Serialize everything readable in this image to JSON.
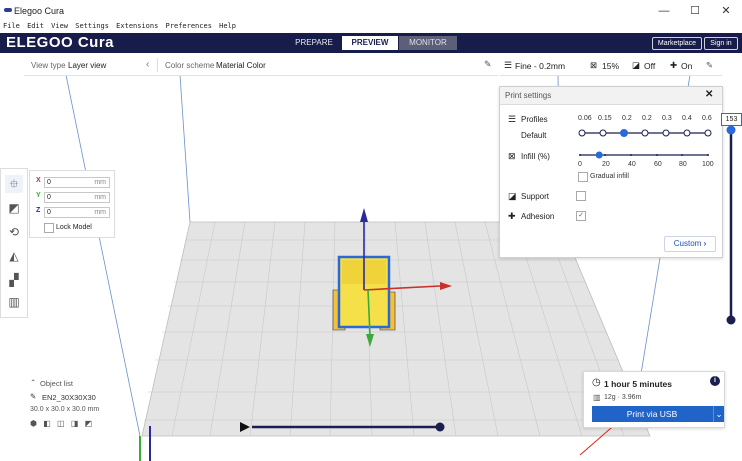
{
  "window": {
    "title": "Elegoo Cura",
    "controls": [
      "—",
      "☐",
      "✕"
    ]
  },
  "menubar": {
    "items": [
      "File",
      "Edit",
      "View",
      "Settings",
      "Extensions",
      "Preferences",
      "Help"
    ]
  },
  "header": {
    "logo": "ELEGOO Cura",
    "stages": [
      "PREPARE",
      "PREVIEW",
      "MONITOR"
    ],
    "active_stage": "PREVIEW",
    "marketplace_label": "Marketplace",
    "signin_label": "Sign in",
    "background_color": "#171c4a"
  },
  "toolbar": {
    "view_type_label": "View type",
    "view_type_value": "Layer view",
    "color_scheme_label": "Color scheme",
    "color_scheme_value": "Material Color"
  },
  "print_summary": {
    "profile": "Fine - 0.2mm",
    "infill": "15%",
    "support": "Off",
    "adhesion": "On"
  },
  "print_settings": {
    "title": "Print settings",
    "close": "✕",
    "profiles_label": "Profiles",
    "default_label": "Default",
    "profile_values": [
      "0.06",
      "0.15",
      "0.2",
      "0.2",
      "0.3",
      "0.4",
      "0.6"
    ],
    "selected_profile_index": 2,
    "infill_label": "Infill (%)",
    "infill_ticks": [
      "0",
      "20",
      "40",
      "60",
      "80",
      "100"
    ],
    "infill_value_percent": 15,
    "gradual_infill_label": "Gradual infill",
    "support_label": "Support",
    "adhesion_label": "Adhesion",
    "adhesion_check": "✓",
    "custom_label": "Custom",
    "custom_chevron": "›"
  },
  "move_panel": {
    "x_label": "X",
    "x_value": "0",
    "x_unit": "mm",
    "y_label": "Y",
    "y_value": "0",
    "y_unit": "mm",
    "z_label": "Z",
    "z_value": "0",
    "z_unit": "mm",
    "lock_model_label": "Lock Model"
  },
  "object_list": {
    "header": "Object list",
    "object_name": "EN2_30X30X30",
    "dimensions": "30.0 x 30.0 x 30.0 mm"
  },
  "print_card": {
    "time": "1 hour 5 minutes",
    "material": "12g · 3.96m",
    "action_label": "Print via USB",
    "accent": "#2164c8"
  },
  "layer_slider": {
    "value": "153"
  },
  "colors": {
    "accent_blue": "#2a6ad8",
    "model_yellow": "#f5e04a",
    "axis_red": "#c8302a",
    "axis_green": "#3aaa3a",
    "axis_blue": "#2a2a9a"
  }
}
